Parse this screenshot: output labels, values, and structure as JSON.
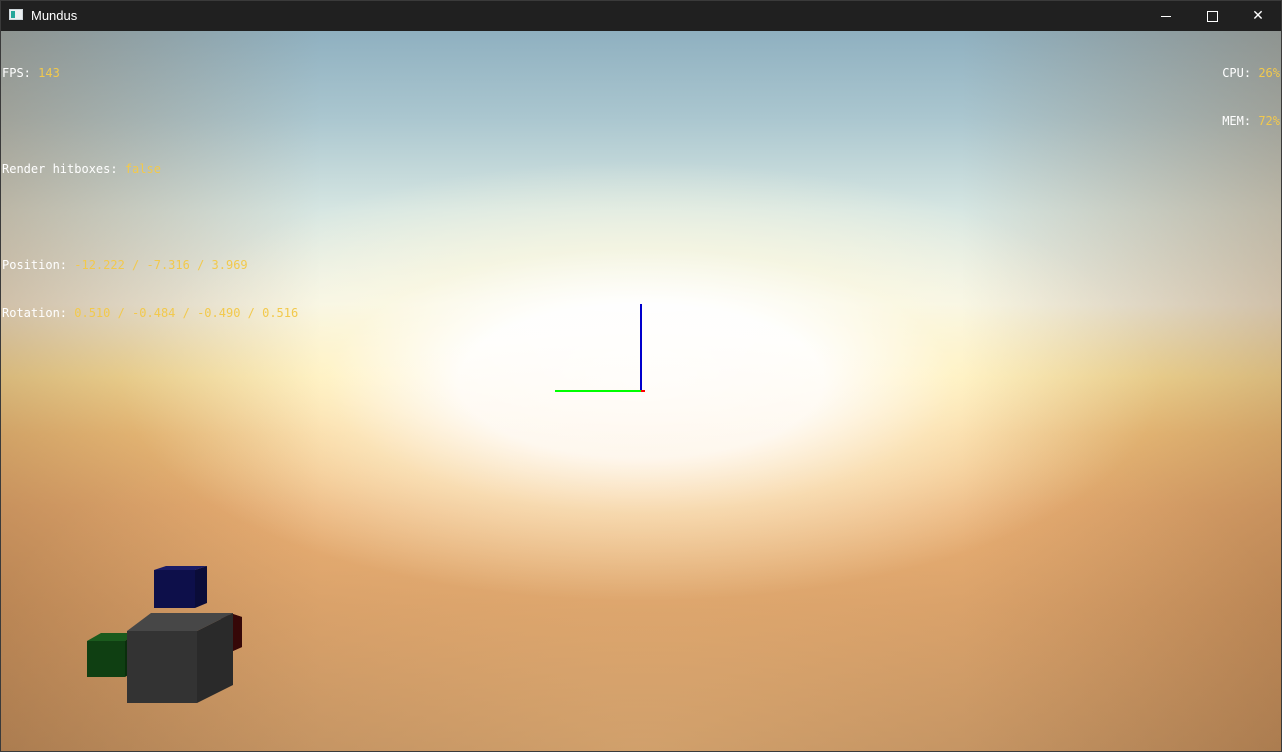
{
  "window": {
    "title": "Mundus",
    "icon": "app-window-icon",
    "controls": {
      "minimize_icon": "minimize-icon",
      "maximize_icon": "maximize-icon",
      "close_icon": "close-icon",
      "close_glyph": "✕"
    }
  },
  "hud": {
    "fps_label": "FPS: ",
    "fps_value": "143",
    "hitboxes_label": "Render hitboxes: ",
    "hitboxes_value": "false",
    "position_label": "Position: ",
    "position_value": "-12.222 / -7.316 / 3.969",
    "rotation_label": "Rotation: ",
    "rotation_value": "0.510 / -0.484 / -0.490 / 0.516",
    "cpu_label": "CPU: ",
    "cpu_value": "26%",
    "mem_label": "MEM: ",
    "mem_value": "72%"
  },
  "scene": {
    "sky": "sunset skybox",
    "colors": {
      "hud_label": "#ffffff",
      "hud_value": "#f2c94c",
      "axis_x": "#ff0000",
      "axis_y": "#00ff00",
      "axis_z": "#0000cc",
      "cube_blue": "#0d0f4a",
      "cube_green": "#0f3f12",
      "cube_red": "#4a0c0c",
      "cube_gray": "#333333"
    }
  }
}
